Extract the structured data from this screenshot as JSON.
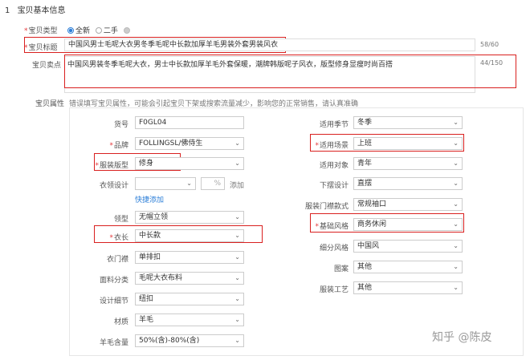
{
  "section": {
    "number": "1",
    "title": "宝贝基本信息"
  },
  "type_row": {
    "label": "宝贝类型",
    "options": [
      "全新",
      "二手"
    ],
    "selected": "全新"
  },
  "title_row": {
    "label": "宝贝标题",
    "value": "中国风男士毛呢大衣男冬季毛呢中长款加厚羊毛男装外套男装风衣",
    "counter": "58/60"
  },
  "selling_row": {
    "label": "宝贝卖点",
    "value": "中国风男装冬季毛呢大衣，男士中长款加厚羊毛外套保暖，潮牌韩版呢子风衣，版型修身显瘦时尚百搭",
    "counter": "44/150"
  },
  "attr_header": {
    "label": "宝贝属性",
    "note": "错误填写宝贝属性，可能会引起宝贝下架或搜索流量减少，影响您的正常销售，请认真准确填写！"
  },
  "left_fields": [
    {
      "name": "huohao",
      "label": "货号",
      "required": false,
      "value": "F0GL04",
      "kind": "input"
    },
    {
      "name": "pinpai",
      "label": "品牌",
      "required": true,
      "value": "FOLLINGSL/佛侍生",
      "kind": "select"
    },
    {
      "name": "fuzhuang-banxing",
      "label": "服装版型",
      "required": true,
      "value": "修身",
      "kind": "select"
    },
    {
      "name": "yifu-menjin",
      "label": "衣领设计",
      "required": false,
      "value": "",
      "kind": "select"
    },
    {
      "name": "lingxing",
      "label": "领型",
      "required": false,
      "value": "无帽立领",
      "kind": "select"
    },
    {
      "name": "yichang",
      "label": "衣长",
      "required": true,
      "value": "中长款",
      "kind": "select"
    },
    {
      "name": "yimenjin",
      "label": "衣门襟",
      "required": false,
      "value": "单排扣",
      "kind": "select"
    },
    {
      "name": "mianliao",
      "label": "面料分类",
      "required": false,
      "value": "毛呢大衣布料",
      "kind": "select"
    },
    {
      "name": "sheji-xijie",
      "label": "设计细节",
      "required": false,
      "value": "纽扣",
      "kind": "select"
    },
    {
      "name": "liaoxing",
      "label": "材质",
      "required": false,
      "value": "羊毛",
      "kind": "select"
    },
    {
      "name": "yangmao-hanliang",
      "label": "羊毛含量",
      "required": false,
      "value": "50%(含)-80%(含)",
      "kind": "select"
    }
  ],
  "collar": {
    "percent_placeholder": "%",
    "add_label": "添加",
    "quick_add": "快捷添加"
  },
  "right_fields": [
    {
      "name": "shiyong-jijie",
      "label": "适用季节",
      "required": false,
      "value": "冬季",
      "kind": "select"
    },
    {
      "name": "shiyong-changjing",
      "label": "适用场景",
      "required": true,
      "value": "上班",
      "kind": "select"
    },
    {
      "name": "shiyong-duixiang",
      "label": "适用对象",
      "required": false,
      "value": "青年",
      "kind": "select"
    },
    {
      "name": "xiabai-sheji",
      "label": "下摆设计",
      "required": false,
      "value": "直摆",
      "kind": "select"
    },
    {
      "name": "fukou-kuanshi",
      "label": "服装门襟款式",
      "required": false,
      "value": "常规袖口",
      "kind": "select"
    },
    {
      "name": "jiben-fengge",
      "label": "基础风格",
      "required": true,
      "value": "商务休闲",
      "kind": "select"
    },
    {
      "name": "xifen-fengge",
      "label": "细分风格",
      "required": false,
      "value": "中国风",
      "kind": "select"
    },
    {
      "name": "tuan",
      "label": "图案",
      "required": false,
      "value": "其他",
      "kind": "select"
    },
    {
      "name": "fuzhuang-gongyi",
      "label": "服装工艺",
      "required": false,
      "value": "其他",
      "kind": "select"
    }
  ],
  "watermark": "知乎 @陈皮",
  "colors": {
    "highlight": "#d9201f",
    "link": "#2d7fd8",
    "required": "#e4393c"
  }
}
